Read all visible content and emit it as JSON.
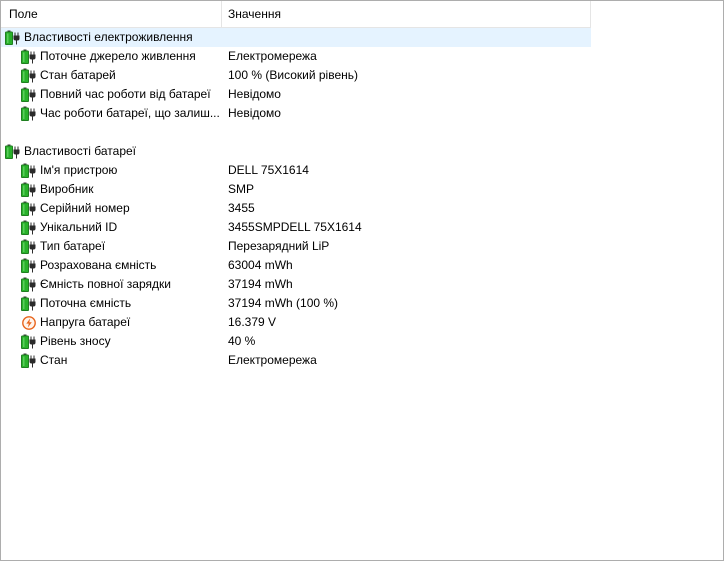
{
  "header": {
    "col_field": "Поле",
    "col_value": "Значення"
  },
  "sections": [
    {
      "title": "Властивості електроживлення",
      "items": [
        {
          "label": "Поточне джерело живлення",
          "value": "Електромережа",
          "icon": "battery-plug-icon"
        },
        {
          "label": "Стан батарей",
          "value": "100 % (Високий рівень)",
          "icon": "battery-plug-icon"
        },
        {
          "label": "Повний час роботи від батареї",
          "value": "Невідомо",
          "icon": "battery-plug-icon"
        },
        {
          "label": "Час роботи батареї, що залиш...",
          "value": "Невідомо",
          "icon": "battery-plug-icon"
        }
      ]
    },
    {
      "title": "Властивості батареї",
      "items": [
        {
          "label": "Ім'я пристрою",
          "value": "DELL 75X1614",
          "icon": "battery-plug-icon"
        },
        {
          "label": "Виробник",
          "value": "SMP",
          "icon": "battery-plug-icon"
        },
        {
          "label": "Серійний номер",
          "value": "3455",
          "icon": "battery-plug-icon"
        },
        {
          "label": "Унікальний ID",
          "value": "3455SMPDELL 75X1614",
          "icon": "battery-plug-icon"
        },
        {
          "label": "Тип батареї",
          "value": "Перезарядний LiP",
          "icon": "battery-plug-icon"
        },
        {
          "label": "Розрахована ємність",
          "value": "63004 mWh",
          "icon": "battery-plug-icon"
        },
        {
          "label": "Ємність повної зарядки",
          "value": "37194 mWh",
          "icon": "battery-plug-icon"
        },
        {
          "label": "Поточна ємність",
          "value": "37194 mWh  (100 %)",
          "icon": "battery-plug-icon"
        },
        {
          "label": "Напруга батареї",
          "value": "16.379 V",
          "icon": "voltage-bolt-icon"
        },
        {
          "label": "Рівень зносу",
          "value": "40 %",
          "icon": "battery-plug-icon"
        },
        {
          "label": "Стан",
          "value": "Електромережа",
          "icon": "battery-plug-icon"
        }
      ]
    }
  ],
  "colors": {
    "selection": "#e5f3ff",
    "battery_green": "#29b12b",
    "bolt_orange": "#e8641b"
  }
}
